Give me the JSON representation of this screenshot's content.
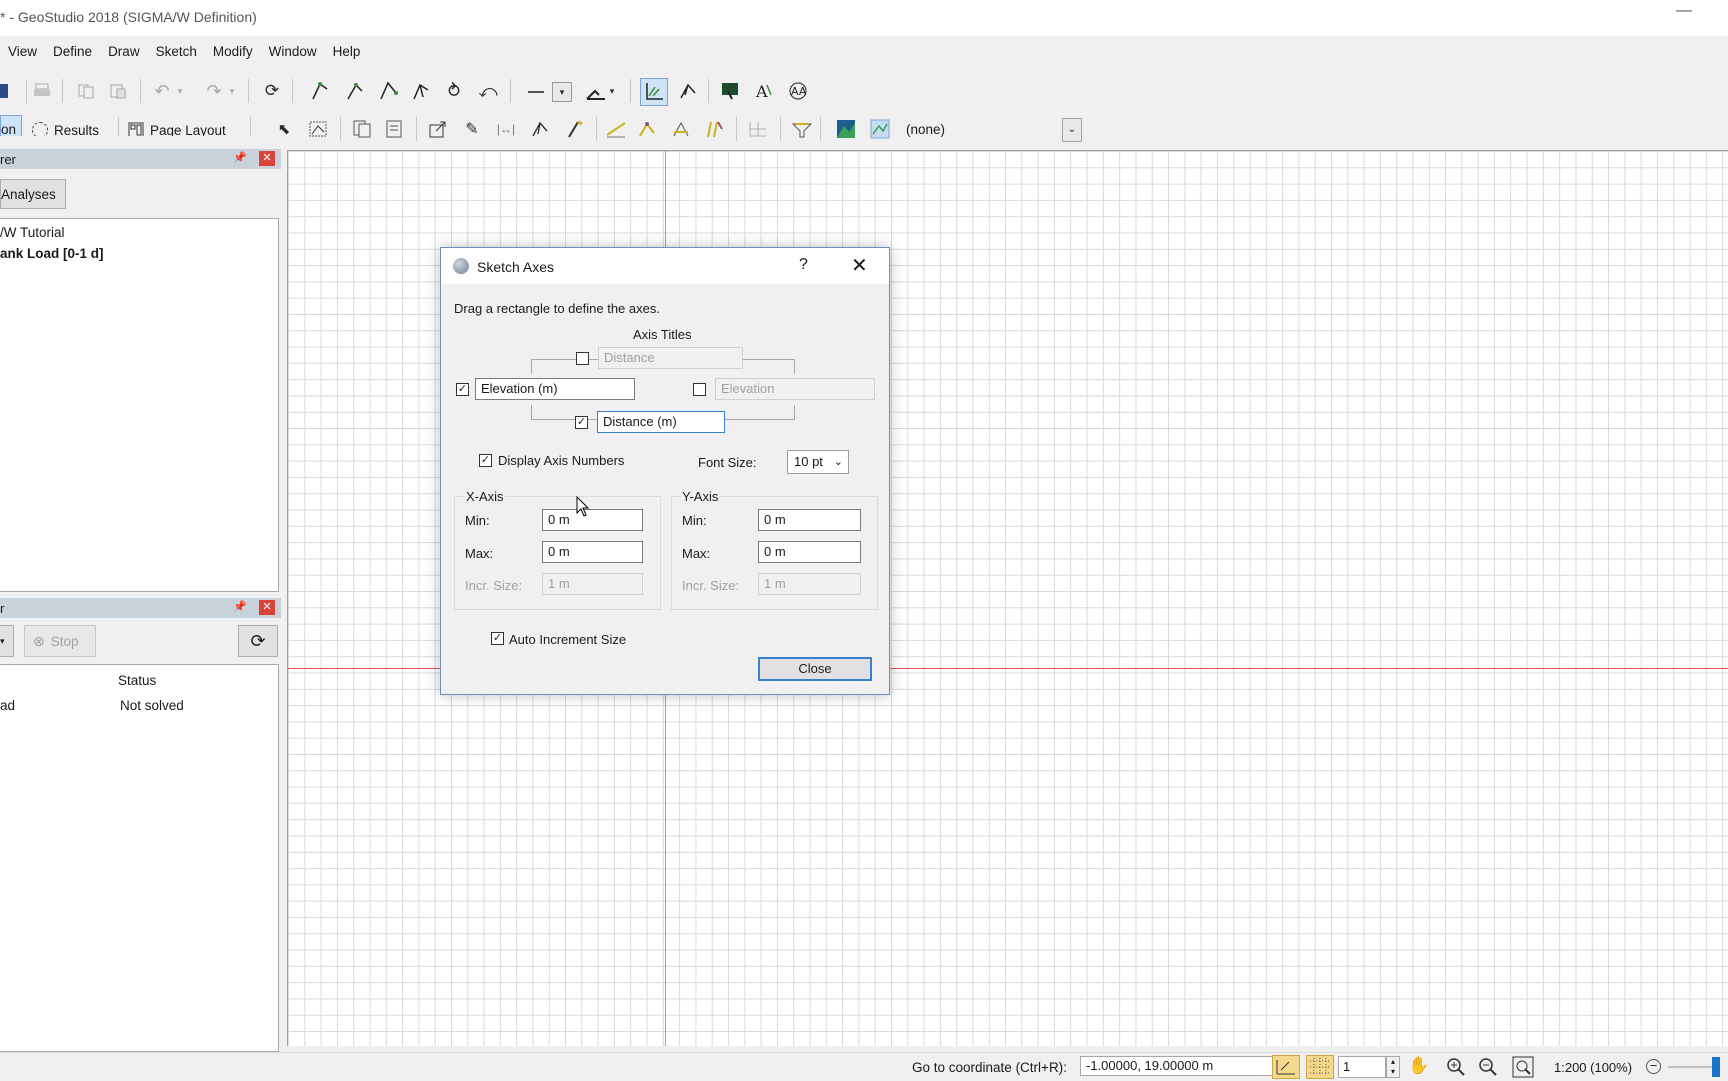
{
  "window": {
    "title": "* - GeoStudio 2018 (SIGMA/W Definition)",
    "minimize_glyph": "—"
  },
  "menu": [
    "View",
    "Define",
    "Draw",
    "Sketch",
    "Modify",
    "Window",
    "Help"
  ],
  "toolbar2": {
    "definition_tab_partial": "on",
    "results_tab": "Results",
    "page_layout_tab": "Page Layout",
    "style_dropdown_value": "(none)"
  },
  "explorer": {
    "header": "rer",
    "analyses_button": "Analyses",
    "tree": [
      {
        "text": "/W Tutorial",
        "bold": false
      },
      {
        "text": "ank Load [0-1 d]",
        "bold": true
      }
    ]
  },
  "solve_manager": {
    "header": "r",
    "stop_button": "Stop",
    "columns": {
      "status": "Status"
    },
    "rows": [
      {
        "name": "ad",
        "status": "Not solved"
      }
    ]
  },
  "dialog": {
    "title": "Sketch Axes",
    "help": "?",
    "instruction": "Drag a rectangle to define the axes.",
    "axis_titles_label": "Axis Titles",
    "top_title": {
      "checked": false,
      "value": "Distance"
    },
    "left_title": {
      "checked": true,
      "value": "Elevation (m)"
    },
    "right_title": {
      "checked": false,
      "value": "Elevation"
    },
    "bottom_title": {
      "checked": true,
      "value": "Distance (m)"
    },
    "display_axis_numbers": {
      "checked": true,
      "label": "Display Axis Numbers"
    },
    "font_size_label": "Font Size:",
    "font_size_value": "10 pt",
    "x_axis": {
      "label": "X-Axis",
      "min_label": "Min:",
      "min": "0 m",
      "max_label": "Max:",
      "max": "0 m",
      "incr_label": "Incr. Size:",
      "incr": "1 m"
    },
    "y_axis": {
      "label": "Y-Axis",
      "min_label": "Min:",
      "min": "0 m",
      "max_label": "Max:",
      "max": "0 m",
      "incr_label": "Incr. Size:",
      "incr": "1 m"
    },
    "auto_increment": {
      "checked": true,
      "label": "Auto Increment Size"
    },
    "close_button": "Close"
  },
  "statusbar": {
    "goto_label": "Go to coordinate (Ctrl+R):",
    "coordinate": "-1.00000, 19.00000 m",
    "grid_spacing": "1",
    "zoom": "1:200 (100%)"
  },
  "colors": {
    "accent": "#3c7fd0",
    "y_axis_line": "#3ddc8c",
    "x_axis_line": "#e2564a",
    "panel_header": "#c9d1da",
    "close_red": "#d9443a"
  }
}
